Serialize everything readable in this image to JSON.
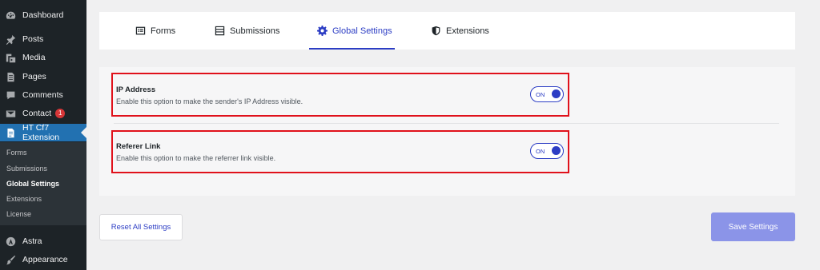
{
  "sidebar": {
    "items": [
      {
        "label": "Dashboard",
        "icon": "dashboard-icon"
      },
      {
        "label": "Posts",
        "icon": "pin-icon"
      },
      {
        "label": "Media",
        "icon": "media-icon"
      },
      {
        "label": "Pages",
        "icon": "pages-icon"
      },
      {
        "label": "Comments",
        "icon": "comment-icon"
      },
      {
        "label": "Contact",
        "icon": "mail-icon",
        "badge": "1"
      },
      {
        "label": "HT Cf7 Extension",
        "icon": "document-icon",
        "active": true
      },
      {
        "label": "Astra",
        "icon": "astra-icon"
      },
      {
        "label": "Appearance",
        "icon": "brush-icon"
      }
    ],
    "submenu": [
      "Forms",
      "Submissions",
      "Global Settings",
      "Extensions",
      "License"
    ],
    "current_submenu": "Global Settings"
  },
  "tabs": [
    {
      "label": "Forms",
      "icon": "form-list-icon"
    },
    {
      "label": "Submissions",
      "icon": "table-icon"
    },
    {
      "label": "Global Settings",
      "icon": "gear-icon",
      "active": true
    },
    {
      "label": "Extensions",
      "icon": "shield-icon"
    }
  ],
  "settings": [
    {
      "title": "IP Address",
      "description": "Enable this option to make the sender's IP Address visible.",
      "toggle": "ON"
    },
    {
      "title": "Referer Link",
      "description": "Enable this option to make the referrer link visible.",
      "toggle": "ON"
    }
  ],
  "buttons": {
    "reset": "Reset All Settings",
    "save": "Save Settings"
  },
  "colors": {
    "accent": "#2c3dc4",
    "sidebar_bg": "#1d2327",
    "active_menu": "#2271b1",
    "highlight": "#e0111b",
    "save_button": "#8b94e8"
  }
}
